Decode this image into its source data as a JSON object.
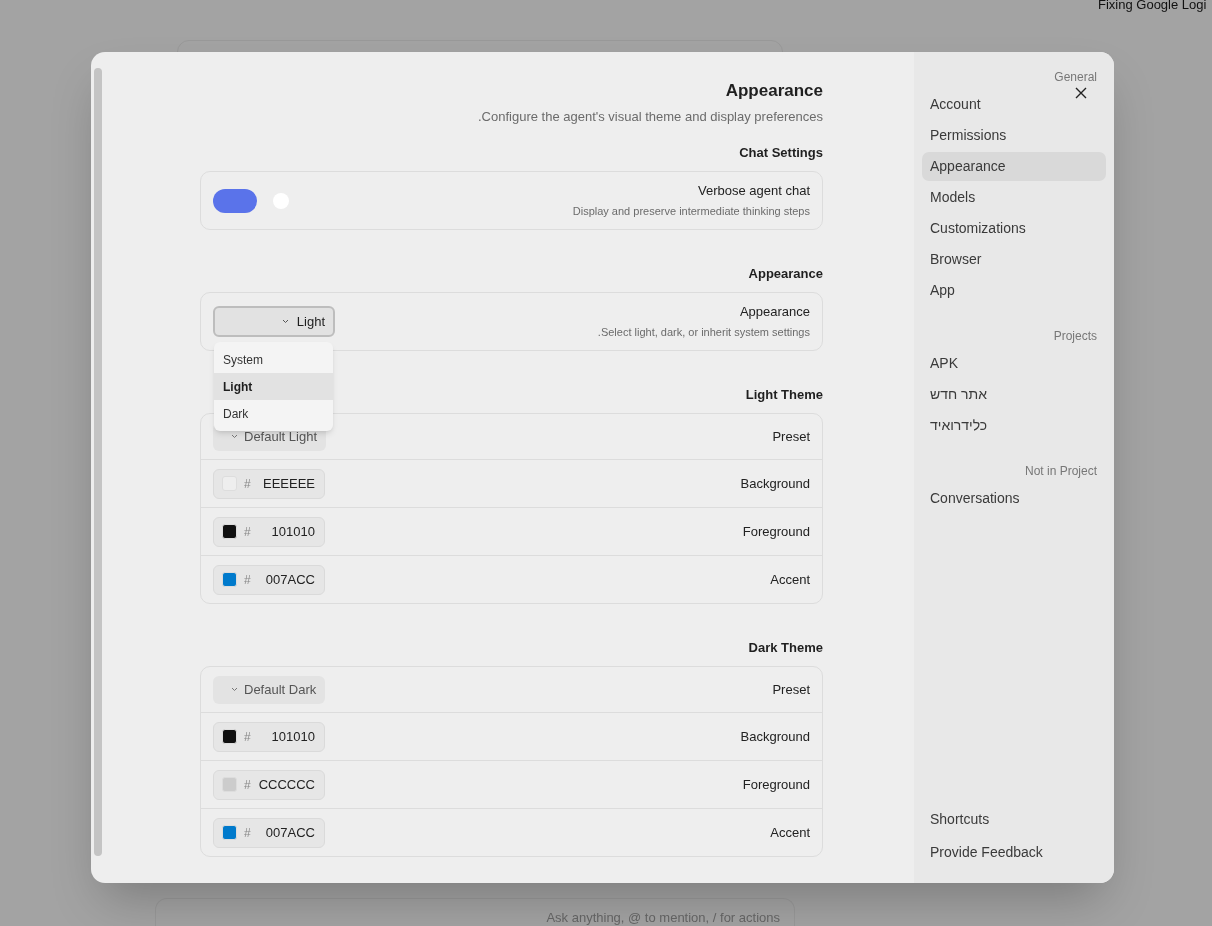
{
  "background": {
    "corner_text": "Fixing Google Logi",
    "composer_placeholder": "Ask anything, @ to mention, / for actions"
  },
  "dialog": {
    "title": "Appearance",
    "description": ".Configure the agent's visual theme and display preferences",
    "sections": [
      {
        "heading": "Chat Settings",
        "rows": [
          {
            "kind": "toggle",
            "label": "Verbose agent chat",
            "hint": "Display and preserve intermediate thinking steps",
            "on": true
          }
        ]
      },
      {
        "heading": "Appearance",
        "rows": [
          {
            "kind": "select",
            "label": "Appearance",
            "hint": ".Select light, dark, or inherit system settings",
            "value": "Light",
            "expanded": true,
            "options": [
              {
                "label": "System",
                "selected": false
              },
              {
                "label": "Light",
                "selected": true
              },
              {
                "label": "Dark",
                "selected": false
              }
            ]
          }
        ]
      },
      {
        "heading": "Light Theme",
        "rows": [
          {
            "kind": "preset",
            "label": "Preset",
            "value": "Default Light"
          },
          {
            "kind": "color",
            "label": "Background",
            "prefix": "#",
            "value": "EEEEEE",
            "color": "#eeeeee"
          },
          {
            "kind": "color",
            "label": "Foreground",
            "prefix": "#",
            "value": "101010",
            "color": "#101010"
          },
          {
            "kind": "color",
            "label": "Accent",
            "prefix": "#",
            "value": "007ACC",
            "color": "#007acc"
          }
        ]
      },
      {
        "heading": "Dark Theme",
        "rows": [
          {
            "kind": "preset",
            "label": "Preset",
            "value": "Default Dark"
          },
          {
            "kind": "color",
            "label": "Background",
            "prefix": "#",
            "value": "101010",
            "color": "#101010"
          },
          {
            "kind": "color",
            "label": "Foreground",
            "prefix": "#",
            "value": "CCCCCC",
            "color": "#cccccc"
          },
          {
            "kind": "color",
            "label": "Accent",
            "prefix": "#",
            "value": "007ACC",
            "color": "#007acc"
          }
        ]
      }
    ]
  },
  "sidebar": {
    "groups": [
      {
        "heading": "General",
        "items": [
          {
            "label": "Account",
            "selected": false
          },
          {
            "label": "Permissions",
            "selected": false
          },
          {
            "label": "Appearance",
            "selected": true
          },
          {
            "label": "Models",
            "selected": false
          },
          {
            "label": "Customizations",
            "selected": false
          },
          {
            "label": "Browser",
            "selected": false
          },
          {
            "label": "App",
            "selected": false
          }
        ]
      },
      {
        "heading": "Projects",
        "items": [
          {
            "label": "APK",
            "selected": false
          },
          {
            "label": "אתר חדש",
            "selected": false
          },
          {
            "label": "כלידרואיד",
            "selected": false
          }
        ]
      },
      {
        "heading": "Not in Project",
        "items": [
          {
            "label": "Conversations",
            "selected": false
          }
        ]
      }
    ],
    "footer_items": [
      {
        "label": "Shortcuts",
        "selected": false
      },
      {
        "label": "Provide Feedback",
        "selected": false
      }
    ]
  }
}
